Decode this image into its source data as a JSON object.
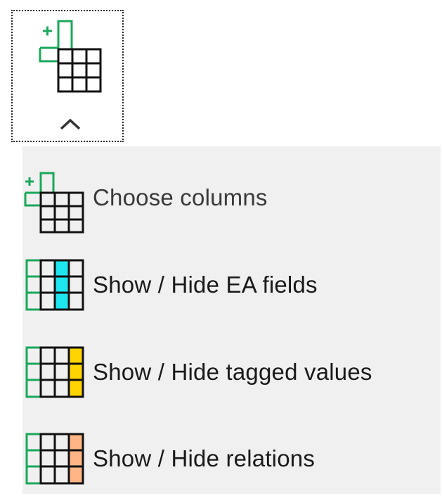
{
  "toolbar": {
    "button_icon": "choose-columns-icon",
    "chevron_icon": "chevron-up-icon"
  },
  "menu": {
    "items": [
      {
        "label": "Choose columns",
        "icon": "choose-columns-icon"
      },
      {
        "label": "Show / Hide EA fields",
        "icon": "table-cyan-column-icon",
        "accent": "#1ee6f0"
      },
      {
        "label": "Show / Hide tagged values",
        "icon": "table-yellow-column-icon",
        "accent": "#ffd400"
      },
      {
        "label": "Show / Hide relations",
        "icon": "table-orange-column-icon",
        "accent": "#ffb585"
      }
    ]
  },
  "colors": {
    "icon_green": "#1aa85a",
    "grid_black": "#111111",
    "menu_background": "#f0f0f0"
  }
}
